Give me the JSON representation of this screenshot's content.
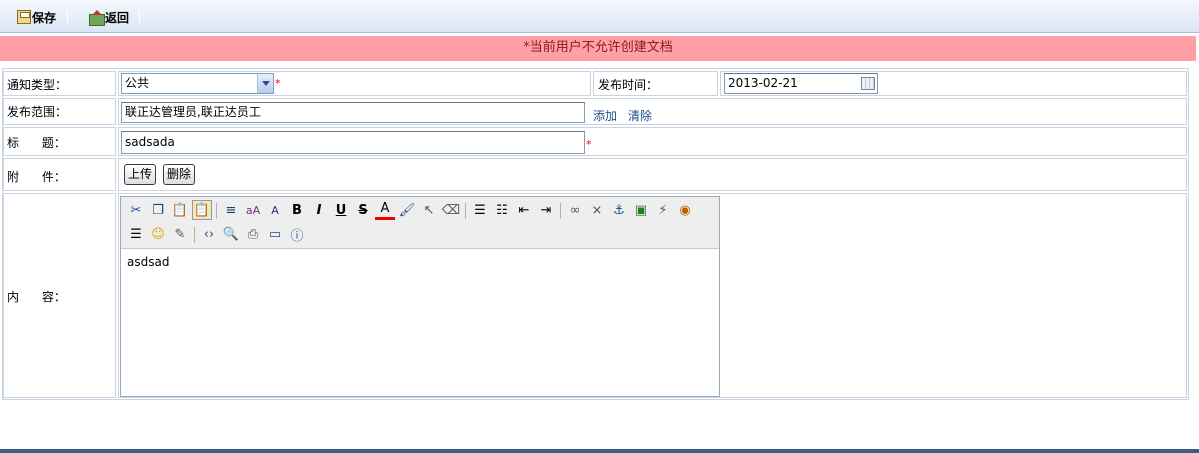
{
  "toolbar": {
    "save_label": "保存",
    "back_label": "返回",
    "save_icon": "save-icon",
    "back_icon": "back-icon"
  },
  "banner": {
    "message": "*当前用户不允许创建文档"
  },
  "form": {
    "notice_type": {
      "label": "通知类型：",
      "value": "公共",
      "required_mark": "*"
    },
    "publish_time": {
      "label": "发布时间：",
      "value": "2013-02-21"
    },
    "publish_scope": {
      "label": "发布范围：",
      "value": "联正达管理员,联正达员工",
      "add_label": "添加",
      "clear_label": "清除"
    },
    "title": {
      "label": "标      题：",
      "value": "sadsada",
      "required_mark": "*"
    },
    "attachment": {
      "label": "附      件：",
      "upload_label": "上传",
      "delete_label": "删除"
    },
    "content": {
      "label": "内      容：",
      "value": "asdsad"
    }
  },
  "editor": {
    "toolbar_row1": [
      "cut",
      "copy",
      "paste",
      "paste-text",
      "format-block",
      "spellcheck",
      "font-size",
      "bold",
      "italic",
      "underline",
      "strikethrough",
      "text-color",
      "highlight",
      "select",
      "eraser",
      "align-left",
      "ordered-list",
      "outdent",
      "indent",
      "link",
      "unlink",
      "anchor",
      "image",
      "flash",
      "media"
    ],
    "toolbar_row2": [
      "horizontal-rule",
      "emoticon",
      "edit",
      "source",
      "preview",
      "print",
      "fullscreen",
      "about"
    ],
    "glyphs": {
      "bold": "B",
      "italic": "I",
      "underline": "U",
      "strikethrough": "S",
      "text_color": "A"
    }
  },
  "colors": {
    "banner_bg": "#ffa0a6",
    "banner_text": "#8b1a1a",
    "link": "#1f4e8c",
    "required": "#e00000",
    "border": "#c8d4e2"
  }
}
